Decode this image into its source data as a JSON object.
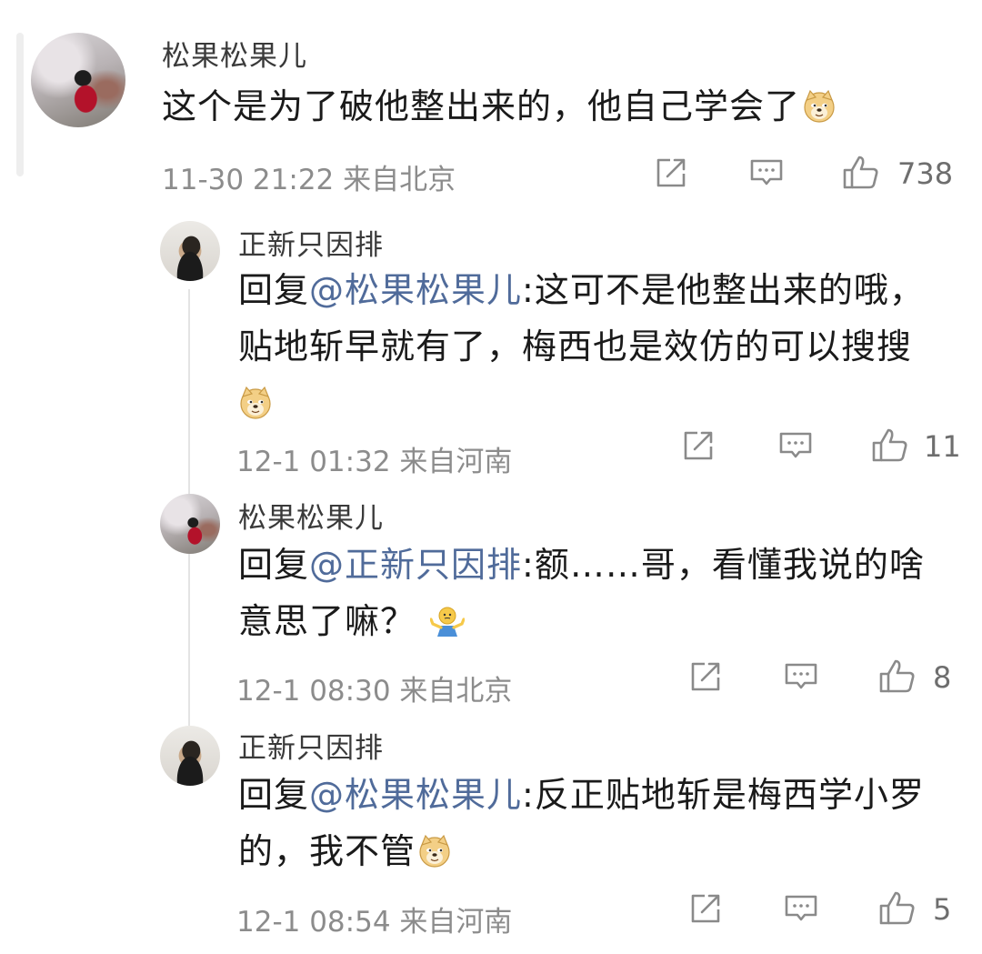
{
  "comments": [
    {
      "user": "松果松果儿",
      "text": "这个是为了破他整出来的，他自己学会了",
      "emoji": "doge-emoji",
      "meta": "11-30 21:22  来自北京",
      "likes": "738"
    },
    {
      "user": "正新只因排",
      "reply_prefix": "回复",
      "mention": "@松果松果儿",
      "text_line1": ":这可不是他整出来的哦，",
      "text_line2": "贴地斩早就有了，梅西也是效仿的可以搜搜",
      "emoji": "doge-emoji",
      "meta": "12-1 01:32  来自河南",
      "likes": "11"
    },
    {
      "user": "松果松果儿",
      "reply_prefix": "回复",
      "mention": "@正新只因排",
      "text_line1": ":额……哥，看懂我说的啥",
      "text_line2": "意思了嘛？",
      "emoji": "shrug-emoji",
      "meta": "12-1 08:30  来自北京",
      "likes": "8"
    },
    {
      "user": "正新只因排",
      "reply_prefix": "回复",
      "mention": "@松果松果儿",
      "text_line1": ":反正贴地斩是梅西学小罗",
      "text_line2": "的，我不管",
      "emoji": "doge-emoji",
      "meta": "12-1 08:54  来自河南",
      "likes": "5"
    }
  ],
  "colors": {
    "mention": "#506b9a",
    "meta": "#8c8c8c",
    "text": "#1a1a1a",
    "icon": "#8a8a8a"
  }
}
